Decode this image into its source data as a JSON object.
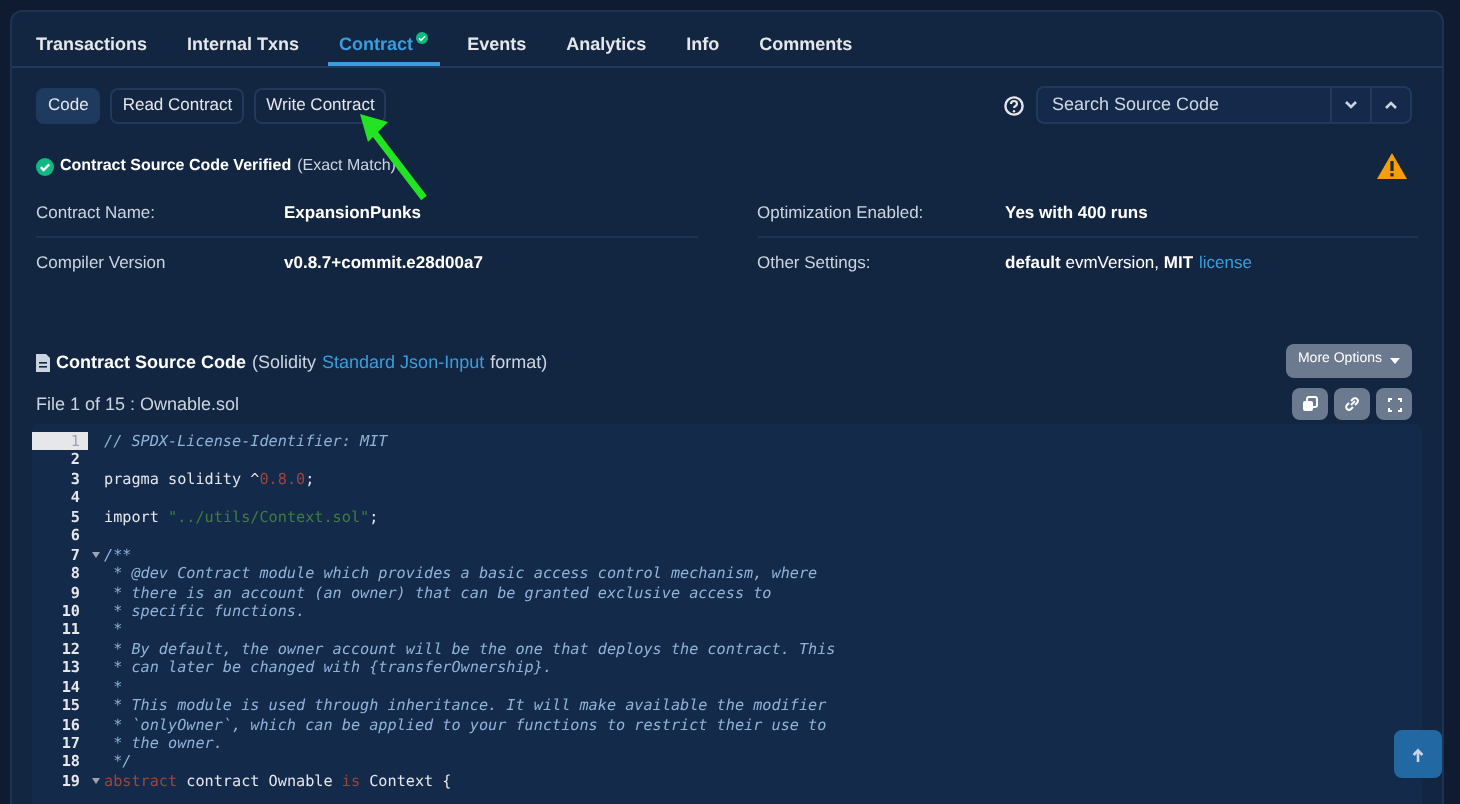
{
  "tabs": [
    {
      "label": "Transactions",
      "selected": false,
      "verified": false
    },
    {
      "label": "Internal Txns",
      "selected": false,
      "verified": false
    },
    {
      "label": "Contract",
      "selected": true,
      "verified": true
    },
    {
      "label": "Events",
      "selected": false,
      "verified": false
    },
    {
      "label": "Analytics",
      "selected": false,
      "verified": false
    },
    {
      "label": "Info",
      "selected": false,
      "verified": false
    },
    {
      "label": "Comments",
      "selected": false,
      "verified": false
    }
  ],
  "subtabs": [
    {
      "label": "Code",
      "selected": true
    },
    {
      "label": "Read Contract",
      "selected": false
    },
    {
      "label": "Write Contract",
      "selected": false
    }
  ],
  "search": {
    "placeholder": "Search Source Code"
  },
  "verified": {
    "title": "Contract Source Code Verified",
    "note": "(Exact Match)"
  },
  "details": [
    {
      "label": "Contract Name:",
      "value": "ExpansionPunks"
    },
    {
      "label": "Optimization Enabled:",
      "value": "Yes with 400 runs"
    },
    {
      "label": "Compiler Version",
      "value": "v0.8.7+commit.e28d00a7"
    },
    {
      "label": "Other Settings:",
      "value": "**default** evmVersion, **MIT**",
      "link": "license"
    }
  ],
  "source": {
    "title": "Contract Source Code",
    "note_before": "(Solidity",
    "link": "Standard Json-Input",
    "note_after": "format)",
    "more_options": "More Options",
    "file": "File 1 of 15 : Ownable.sol"
  },
  "code": [
    {
      "number": "1",
      "selected": true,
      "foldable": false,
      "tokens": [
        {
          "kind": "comment",
          "text": "// SPDX-License-Identifier: MIT"
        }
      ]
    },
    {
      "number": "2",
      "selected": false,
      "foldable": false
    },
    {
      "number": "3",
      "selected": false,
      "foldable": false,
      "tokens": [
        {
          "kind": "plain",
          "text": "pragma solidity ^"
        },
        {
          "kind": "number",
          "text": "0.8.0"
        },
        {
          "kind": "plain",
          "text": ";"
        }
      ]
    },
    {
      "number": "4",
      "selected": false,
      "foldable": false
    },
    {
      "number": "5",
      "selected": false,
      "foldable": false,
      "tokens": [
        {
          "kind": "plain",
          "text": "import "
        },
        {
          "kind": "string",
          "text": "\"../utils/Context.sol\""
        },
        {
          "kind": "plain",
          "text": ";"
        }
      ]
    },
    {
      "number": "6",
      "selected": false,
      "foldable": false
    },
    {
      "number": "7",
      "selected": false,
      "foldable": true,
      "tokens": [
        {
          "kind": "comment",
          "text": "/**"
        }
      ]
    },
    {
      "number": "8",
      "selected": false,
      "foldable": false,
      "tokens": [
        {
          "kind": "comment",
          "text": " * @dev Contract module which provides a basic access control mechanism, where"
        }
      ]
    },
    {
      "number": "9",
      "selected": false,
      "foldable": false,
      "tokens": [
        {
          "kind": "comment",
          "text": " * there is an account (an owner) that can be granted exclusive access to"
        }
      ]
    },
    {
      "number": "10",
      "selected": false,
      "foldable": false,
      "tokens": [
        {
          "kind": "comment",
          "text": " * specific functions."
        }
      ]
    },
    {
      "number": "11",
      "selected": false,
      "foldable": false,
      "tokens": [
        {
          "kind": "comment",
          "text": " *"
        }
      ]
    },
    {
      "number": "12",
      "selected": false,
      "foldable": false,
      "tokens": [
        {
          "kind": "comment",
          "text": " * By default, the owner account will be the one that deploys the contract. This"
        }
      ]
    },
    {
      "number": "13",
      "selected": false,
      "foldable": false,
      "tokens": [
        {
          "kind": "comment",
          "text": " * can later be changed with {transferOwnership}."
        }
      ]
    },
    {
      "number": "14",
      "selected": false,
      "foldable": false,
      "tokens": [
        {
          "kind": "comment",
          "text": " *"
        }
      ]
    },
    {
      "number": "15",
      "selected": false,
      "foldable": false,
      "tokens": [
        {
          "kind": "comment",
          "text": " * This module is used through inheritance. It will make available the modifier"
        }
      ]
    },
    {
      "number": "16",
      "selected": false,
      "foldable": false,
      "tokens": [
        {
          "kind": "comment",
          "text": " * `onlyOwner`, which can be applied to your functions to restrict their use to"
        }
      ]
    },
    {
      "number": "17",
      "selected": false,
      "foldable": false,
      "tokens": [
        {
          "kind": "comment",
          "text": " * the owner."
        }
      ]
    },
    {
      "number": "18",
      "selected": false,
      "foldable": false,
      "tokens": [
        {
          "kind": "comment",
          "text": " */"
        }
      ]
    },
    {
      "number": "19",
      "selected": false,
      "foldable": true,
      "tokens": [
        {
          "kind": "keyword",
          "text": "abstract"
        },
        {
          "kind": "plain",
          "text": " contract Ownable "
        },
        {
          "kind": "keyword",
          "text": "is"
        },
        {
          "kind": "plain",
          "text": " Context {"
        }
      ]
    }
  ]
}
